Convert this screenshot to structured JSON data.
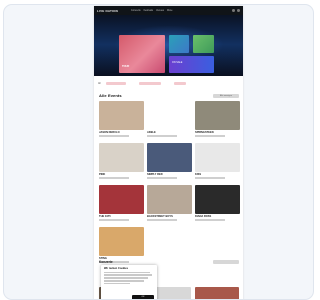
{
  "site": {
    "logo_text": "LIVE NATION",
    "nav": [
      "Concerts",
      "Festivals",
      "Venues",
      "More"
    ]
  },
  "hero": {
    "main_caption": "TOUR",
    "side_caption": "ON SALE"
  },
  "filters": {
    "label": "All"
  },
  "section": {
    "title": "Alle Events",
    "button_label": "Alle anzeigen"
  },
  "cards": [
    {
      "title": "JASON DERULO",
      "color": "#c9b29a"
    },
    {
      "title": "ADELE",
      "color": "#ffffff"
    },
    {
      "title": "SPRINGSTEEN",
      "color": "#8f8a7a"
    },
    {
      "title": "PINK",
      "color": "#d9d2c8"
    },
    {
      "title": "SIMPLY RED",
      "color": "#4a5a7a"
    },
    {
      "title": "KISS",
      "color": "#e8e8e8"
    },
    {
      "title": "THE 1975",
      "color": "#a4343a"
    },
    {
      "title": "BACKSTREET BOYS",
      "color": "#b7a898"
    },
    {
      "title": "DIANA ROSS",
      "color": "#2a2a2a"
    },
    {
      "title": "STING",
      "color": "#d9a86a"
    }
  ],
  "cookie": {
    "title": "Wir nutzen Cookies",
    "accept_label": "OK"
  },
  "section2": {
    "title": "Konzerte"
  },
  "row2_colors": [
    "#6b5a4a",
    "#d8d8d8",
    "#a8584a"
  ]
}
